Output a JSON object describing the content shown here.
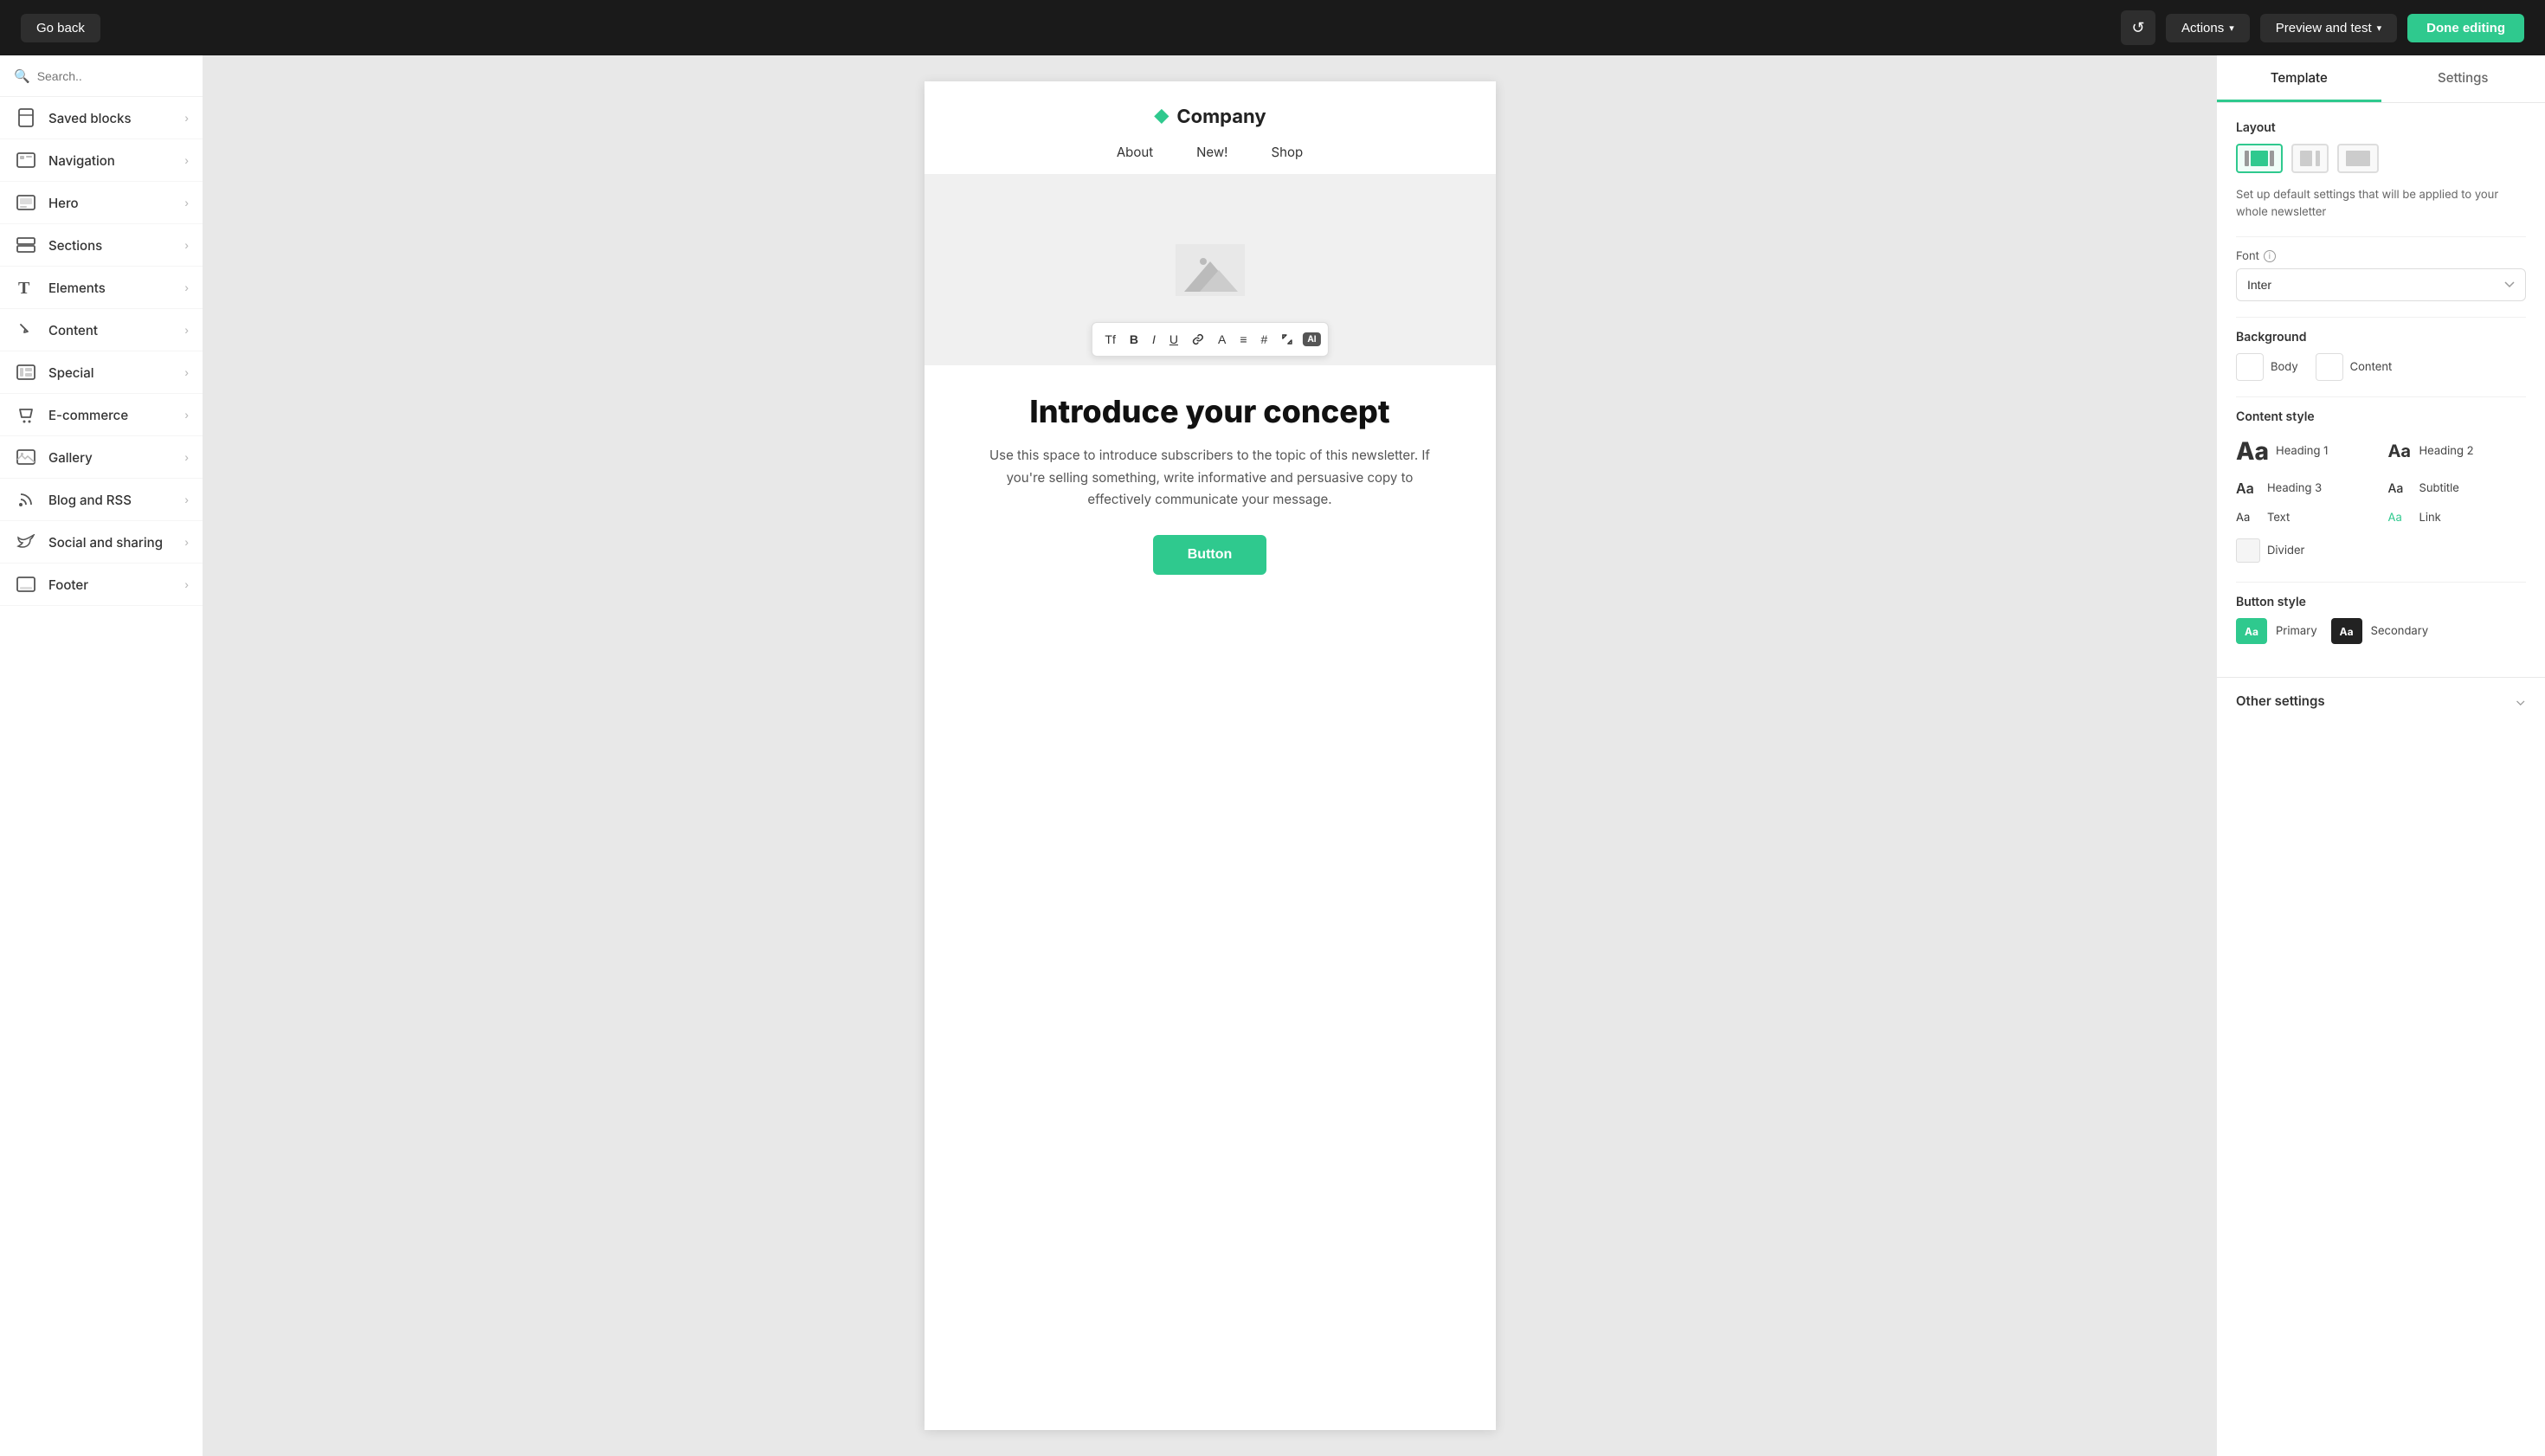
{
  "topbar": {
    "go_back_label": "Go back",
    "actions_label": "Actions",
    "preview_label": "Preview and test",
    "done_label": "Done editing"
  },
  "sidebar": {
    "search_placeholder": "Search..",
    "items": [
      {
        "id": "saved-blocks",
        "label": "Saved blocks",
        "icon": "bookmark"
      },
      {
        "id": "navigation",
        "label": "Navigation",
        "icon": "grid"
      },
      {
        "id": "hero",
        "label": "Hero",
        "icon": "layout"
      },
      {
        "id": "sections",
        "label": "Sections",
        "icon": "sections"
      },
      {
        "id": "elements",
        "label": "Elements",
        "icon": "text"
      },
      {
        "id": "content",
        "label": "Content",
        "icon": "cursor"
      },
      {
        "id": "special",
        "label": "Special",
        "icon": "special"
      },
      {
        "id": "ecommerce",
        "label": "E-commerce",
        "icon": "tag"
      },
      {
        "id": "gallery",
        "label": "Gallery",
        "icon": "image"
      },
      {
        "id": "blog-rss",
        "label": "Blog and RSS",
        "icon": "rss"
      },
      {
        "id": "social",
        "label": "Social and sharing",
        "icon": "twitter"
      },
      {
        "id": "footer",
        "label": "Footer",
        "icon": "footer"
      }
    ]
  },
  "canvas": {
    "email": {
      "logo_text": "Company",
      "nav_links": [
        "About",
        "New!",
        "Shop"
      ],
      "headline": "Introduce your concept",
      "body_text": "Use this space to introduce subscribers to the topic of this newsletter. If you're selling something, write informative and persuasive copy to effectively communicate your message.",
      "button_label": "Button"
    }
  },
  "toolbar": {
    "buttons": [
      "Tf",
      "B",
      "I",
      "U",
      "🔗",
      "A",
      "≡",
      "#",
      "⤢"
    ],
    "ai_badge": "AI"
  },
  "right_panel": {
    "tabs": [
      {
        "id": "template",
        "label": "Template"
      },
      {
        "id": "settings",
        "label": "Settings"
      }
    ],
    "active_tab": "template",
    "layout_label": "Layout",
    "settings_description": "Set up default settings that will be applied to your whole newsletter",
    "font_label": "Font",
    "font_value": "Inter",
    "background_label": "Background",
    "body_label": "Body",
    "content_label": "Content",
    "content_style_label": "Content style",
    "style_items": [
      {
        "id": "heading1",
        "aa": "Aа",
        "size": "large",
        "label": "Heading 1"
      },
      {
        "id": "heading2",
        "aa": "Aa",
        "size": "medium",
        "label": "Heading 2"
      },
      {
        "id": "heading3",
        "aa": "Aa",
        "size": "small-bold",
        "label": "Heading 3"
      },
      {
        "id": "subtitle",
        "aa": "Aa",
        "size": "small",
        "label": "Subtitle"
      },
      {
        "id": "text",
        "aa": "Aa",
        "size": "small",
        "label": "Text"
      },
      {
        "id": "link",
        "aa": "Aa",
        "size": "green",
        "label": "Link"
      }
    ],
    "divider_label": "Divider",
    "button_style_label": "Button style",
    "primary_label": "Primary",
    "secondary_label": "Secondary",
    "other_settings_label": "Other settings"
  }
}
